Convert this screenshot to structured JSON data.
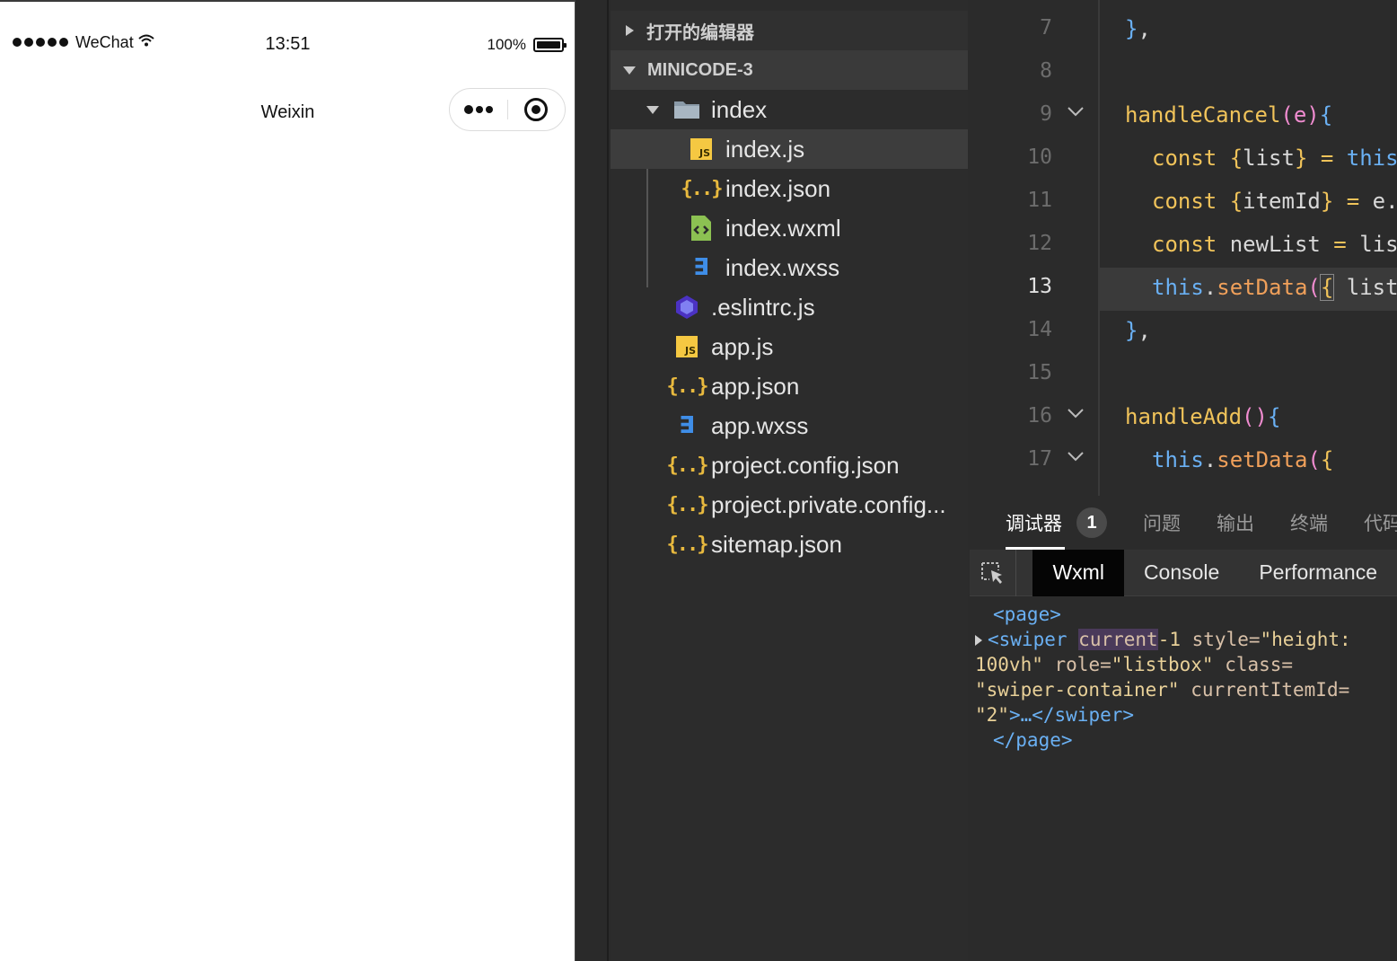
{
  "phone": {
    "carrier": "WeChat",
    "time": "13:51",
    "battery": "100%",
    "battery_level": 1.0,
    "nav_title": "Weixin"
  },
  "explorer": {
    "open_editors": "打开的编辑器",
    "project": "MINICODE-3",
    "folder": "index",
    "files": [
      {
        "name": "index.js",
        "icon": "js-icon"
      },
      {
        "name": "index.json",
        "icon": "json-icon"
      },
      {
        "name": "index.wxml",
        "icon": "wxml-icon"
      },
      {
        "name": "index.wxss",
        "icon": "css-icon"
      },
      {
        "name": ".eslintrc.js",
        "icon": "eslint-icon"
      },
      {
        "name": "app.js",
        "icon": "js-icon"
      },
      {
        "name": "app.json",
        "icon": "json-icon"
      },
      {
        "name": "app.wxss",
        "icon": "css-icon"
      },
      {
        "name": "project.config.json",
        "icon": "json-icon"
      },
      {
        "name": "project.private.config...",
        "icon": "json-icon"
      },
      {
        "name": "sitemap.json",
        "icon": "json-icon"
      }
    ],
    "selected": "index.js"
  },
  "editor": {
    "line_numbers": [
      "7",
      "8",
      "9",
      "10",
      "11",
      "12",
      "13",
      "14",
      "15",
      "16",
      "17"
    ],
    "current_line": "13"
  },
  "debug": {
    "tabs": [
      "调试器",
      "问题",
      "输出",
      "终端",
      "代码"
    ],
    "badge": "1",
    "tool_tabs": [
      "Wxml",
      "Console",
      "Performance"
    ],
    "wxml": {
      "page_open": "<page>",
      "swiper_tag": "<swiper",
      "attr_current": "current",
      "val_current": "-1",
      "attr_style": "style=",
      "val_style": "\"height: 100vh\"",
      "attr_role": "role=",
      "val_role": "\"listbox\"",
      "attr_class": "class=",
      "val_class": "\"swiper-container\"",
      "attr_item": "currentItemId=",
      "val_item": "\"2\"",
      "swiper_close": ">…</swiper>",
      "page_close": "</page>"
    }
  }
}
